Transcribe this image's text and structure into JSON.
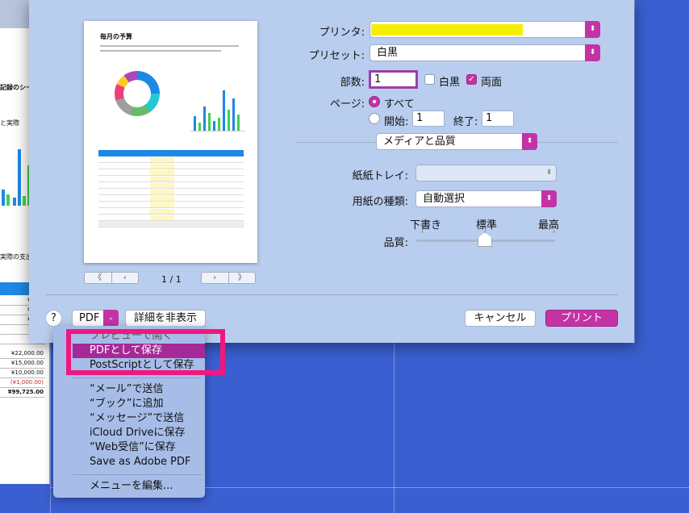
{
  "background_sheet": {
    "texts": [
      "記録のシー",
      "と実際",
      "実際の支出"
    ],
    "cells": [
      "¥11,0",
      "¥16,8",
      "¥14,4",
      "¥5,0",
      "¥6,5",
      "¥22,000.00",
      "¥15,000.00",
      "¥10,000.00",
      "(¥1,000.00)",
      "¥99,725.00"
    ]
  },
  "preview": {
    "doc_title": "毎月の予算",
    "page_counter": "1 / 1",
    "first_label": "《",
    "prev_label": "‹",
    "next_label": "›",
    "last_label": "》"
  },
  "printer": {
    "label": "プリンタ:",
    "value": "",
    "highlight_color": "#f5ef00"
  },
  "preset": {
    "label": "プリセット:",
    "value": "白黒"
  },
  "copies": {
    "label": "部数:",
    "value": "1",
    "bw_label": "白黒",
    "bw_checked": false,
    "duplex_label": "両面",
    "duplex_checked": true
  },
  "pages": {
    "label": "ページ:",
    "all_label": "すべて",
    "from_label": "開始:",
    "from_value": "1",
    "to_label": "終了:",
    "to_value": "1"
  },
  "section_select": {
    "value": "メディアと品質"
  },
  "paper_tray": {
    "label": "紙紙トレイ:",
    "value": ""
  },
  "paper_type": {
    "label": "用紙の種類:",
    "value": "自動選択"
  },
  "quality": {
    "label": "品質:",
    "low": "下書き",
    "mid": "標準",
    "high": "最高",
    "level": 0.5
  },
  "footer": {
    "help": "?",
    "pdf_label": "PDF",
    "hide_details": "詳細を非表示",
    "cancel": "キャンセル",
    "print": "プリント"
  },
  "pdf_menu": {
    "items": [
      "プレビューで開く",
      "PDFとして保存",
      "PostScriptとして保存",
      "“メール”で送信",
      "“ブック”に追加",
      "“メッセージ”で送信",
      "iCloud Driveに保存",
      "“Web受信”に保存",
      "Save as Adobe PDF",
      "メニューを編集..."
    ],
    "selected_index": 1
  },
  "colors": {
    "accent": "#c433a6",
    "highlight_box": "#f0177f",
    "desktop": "#3a5fd0"
  }
}
